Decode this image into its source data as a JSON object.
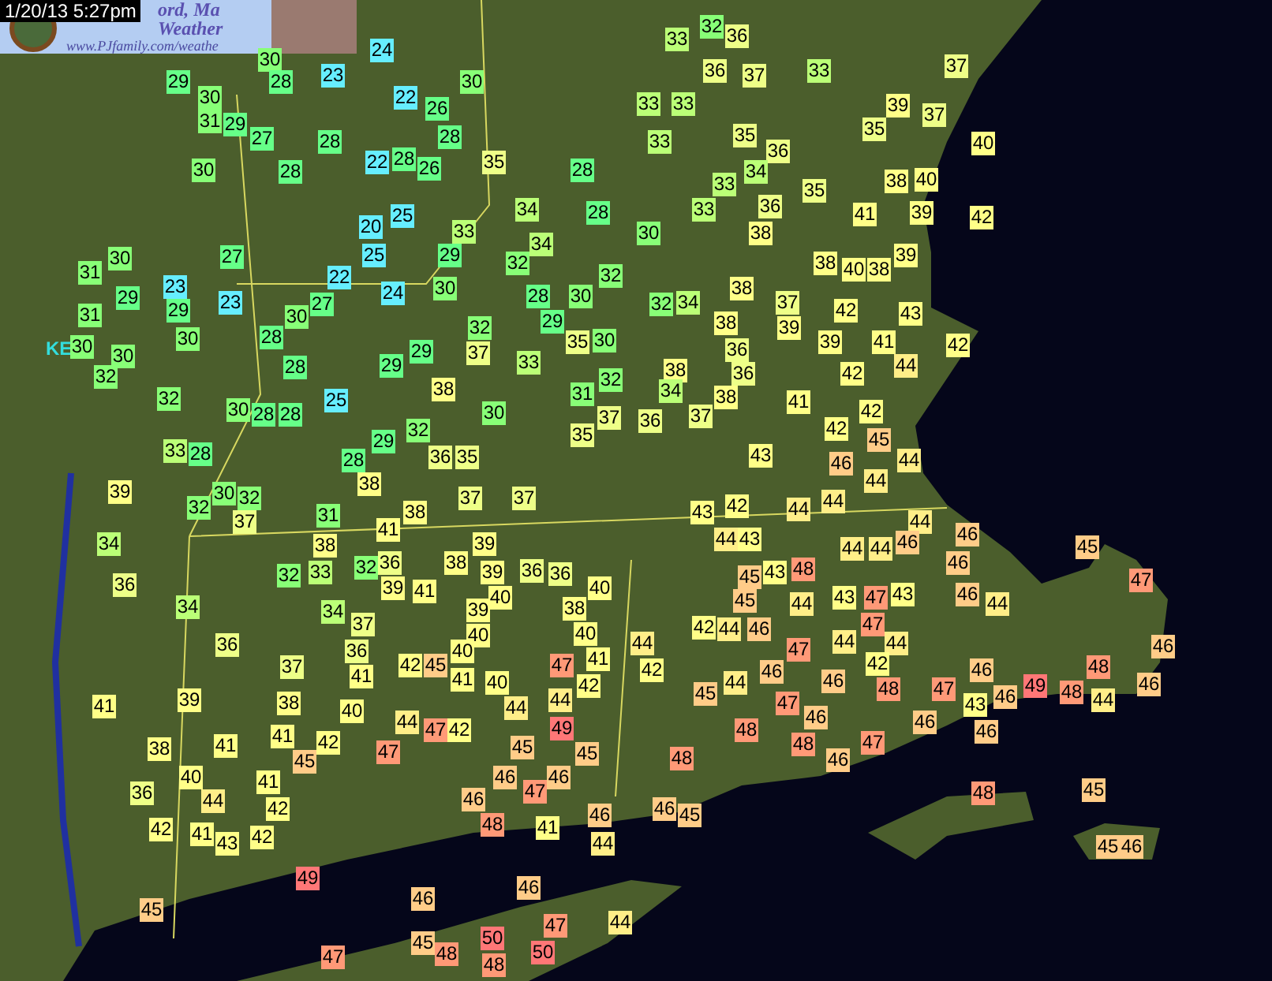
{
  "timestamp": "1/20/13 5:27pm",
  "banner": {
    "title": "ord, Ma",
    "subtitle": "Weather",
    "url": "www.PJfamily.com/weathe"
  },
  "map_label": "KE",
  "stations": [
    {
      "text": "24",
      "color": "#66eeff"
    },
    {
      "text": "30",
      "color": "#88ff77"
    },
    {
      "text": "29",
      "color": "#66ff88"
    },
    {
      "text": "28",
      "color": "#66ff88"
    },
    {
      "text": "23",
      "color": "#66eeff"
    },
    {
      "text": "30",
      "color": "#88ff77"
    },
    {
      "text": "30",
      "color": "#88ff77"
    },
    {
      "text": "22",
      "color": "#66eeff"
    },
    {
      "text": "26",
      "color": "#66ff88"
    },
    {
      "text": "31",
      "color": "#88ff77"
    },
    {
      "text": "29",
      "color": "#66ff88"
    },
    {
      "text": "27",
      "color": "#66ff88"
    },
    {
      "text": "28",
      "color": "#66ff88"
    },
    {
      "text": "28",
      "color": "#66ff88"
    },
    {
      "text": "30",
      "color": "#88ff77"
    },
    {
      "text": "28",
      "color": "#66ff88"
    },
    {
      "text": "22",
      "color": "#66eeff"
    },
    {
      "text": "28",
      "color": "#66ff88"
    },
    {
      "text": "26",
      "color": "#66ff88"
    },
    {
      "text": "35",
      "color": "#eeff88"
    },
    {
      "text": "28",
      "color": "#66ff88"
    },
    {
      "text": "25",
      "color": "#66eeff"
    },
    {
      "text": "20",
      "color": "#66eeff"
    },
    {
      "text": "34",
      "color": "#bbff77"
    },
    {
      "text": "28",
      "color": "#66ff88"
    },
    {
      "text": "27",
      "color": "#66ff88"
    },
    {
      "text": "25",
      "color": "#66eeff"
    },
    {
      "text": "22",
      "color": "#66eeff"
    },
    {
      "text": "24",
      "color": "#66eeff"
    },
    {
      "text": "30",
      "color": "#88ff77"
    },
    {
      "text": "28",
      "color": "#66ff88"
    },
    {
      "text": "29",
      "color": "#66ff88"
    },
    {
      "text": "30",
      "color": "#88ff77"
    },
    {
      "text": "23",
      "color": "#66eeff"
    },
    {
      "text": "31",
      "color": "#88ff77"
    },
    {
      "text": "30",
      "color": "#88ff77"
    },
    {
      "text": "23",
      "color": "#66eeff"
    },
    {
      "text": "27",
      "color": "#66ff88"
    },
    {
      "text": "30",
      "color": "#88ff77"
    },
    {
      "text": "28",
      "color": "#66ff88"
    },
    {
      "text": "29",
      "color": "#66ff88"
    },
    {
      "text": "29",
      "color": "#66ff88"
    },
    {
      "text": "31",
      "color": "#88ff77"
    },
    {
      "text": "30",
      "color": "#88ff77"
    },
    {
      "text": "30",
      "color": "#88ff77"
    },
    {
      "text": "30",
      "color": "#88ff77"
    },
    {
      "text": "32",
      "color": "#88ff77"
    },
    {
      "text": "32",
      "color": "#88ff77"
    },
    {
      "text": "35",
      "color": "#eeff88"
    },
    {
      "text": "30",
      "color": "#88ff77"
    },
    {
      "text": "29",
      "color": "#66ff88"
    },
    {
      "text": "37",
      "color": "#eeff88"
    },
    {
      "text": "29",
      "color": "#66ff88"
    },
    {
      "text": "33",
      "color": "#bbff77"
    },
    {
      "text": "38",
      "color": "#ffff88"
    },
    {
      "text": "28",
      "color": "#66ff88"
    },
    {
      "text": "32",
      "color": "#88ff77"
    },
    {
      "text": "25",
      "color": "#66eeff"
    },
    {
      "text": "30",
      "color": "#88ff77"
    },
    {
      "text": "28",
      "color": "#66ff88"
    },
    {
      "text": "28",
      "color": "#66ff88"
    },
    {
      "text": "30",
      "color": "#88ff77"
    },
    {
      "text": "32",
      "color": "#88ff77"
    },
    {
      "text": "31",
      "color": "#88ff77"
    },
    {
      "text": "37",
      "color": "#eeff88"
    },
    {
      "text": "35",
      "color": "#eeff88"
    },
    {
      "text": "29",
      "color": "#66ff88"
    },
    {
      "text": "32",
      "color": "#88ff77"
    },
    {
      "text": "33",
      "color": "#bbff77"
    },
    {
      "text": "28",
      "color": "#66ff88"
    },
    {
      "text": "28",
      "color": "#66ff88"
    },
    {
      "text": "36",
      "color": "#eeff88"
    },
    {
      "text": "35",
      "color": "#eeff88"
    },
    {
      "text": "29",
      "color": "#66ff88"
    },
    {
      "text": "34",
      "color": "#bbff77"
    },
    {
      "text": "32",
      "color": "#88ff77"
    },
    {
      "text": "33",
      "color": "#bbff77"
    },
    {
      "text": "32",
      "color": "#88ff77"
    },
    {
      "text": "32",
      "color": "#88ff77"
    },
    {
      "text": "33",
      "color": "#bbff77"
    },
    {
      "text": "36",
      "color": "#eeff88"
    },
    {
      "text": "36",
      "color": "#eeff88"
    },
    {
      "text": "37",
      "color": "#eeff88"
    },
    {
      "text": "33",
      "color": "#bbff77"
    },
    {
      "text": "37",
      "color": "#eeff88"
    },
    {
      "text": "33",
      "color": "#bbff77"
    },
    {
      "text": "33",
      "color": "#bbff77"
    },
    {
      "text": "39",
      "color": "#ffff88"
    },
    {
      "text": "37",
      "color": "#eeff88"
    },
    {
      "text": "35",
      "color": "#eeff88"
    },
    {
      "text": "33",
      "color": "#bbff77"
    },
    {
      "text": "35",
      "color": "#eeff88"
    },
    {
      "text": "36",
      "color": "#eeff88"
    },
    {
      "text": "40",
      "color": "#ffff88"
    },
    {
      "text": "34",
      "color": "#bbff77"
    },
    {
      "text": "33",
      "color": "#bbff77"
    },
    {
      "text": "35",
      "color": "#eeff88"
    },
    {
      "text": "38",
      "color": "#ffff88"
    },
    {
      "text": "40",
      "color": "#ffff88"
    },
    {
      "text": "33",
      "color": "#bbff77"
    },
    {
      "text": "36",
      "color": "#eeff88"
    },
    {
      "text": "41",
      "color": "#ffff88"
    },
    {
      "text": "39",
      "color": "#ffff88"
    },
    {
      "text": "42",
      "color": "#ffff88"
    },
    {
      "text": "30",
      "color": "#88ff77"
    },
    {
      "text": "38",
      "color": "#ffff88"
    },
    {
      "text": "38",
      "color": "#ffff88"
    },
    {
      "text": "39",
      "color": "#ffff88"
    },
    {
      "text": "40",
      "color": "#ffff88"
    },
    {
      "text": "38",
      "color": "#ffff88"
    },
    {
      "text": "38",
      "color": "#ffff88"
    },
    {
      "text": "32",
      "color": "#88ff77"
    },
    {
      "text": "34",
      "color": "#bbff77"
    },
    {
      "text": "37",
      "color": "#eeff88"
    },
    {
      "text": "38",
      "color": "#ffff88"
    },
    {
      "text": "42",
      "color": "#ffff88"
    },
    {
      "text": "43",
      "color": "#ffff88"
    },
    {
      "text": "39",
      "color": "#ffff88"
    },
    {
      "text": "36",
      "color": "#eeff88"
    },
    {
      "text": "39",
      "color": "#ffff88"
    },
    {
      "text": "41",
      "color": "#ffff88"
    },
    {
      "text": "42",
      "color": "#ffff88"
    },
    {
      "text": "38",
      "color": "#ffff88"
    },
    {
      "text": "36",
      "color": "#eeff88"
    },
    {
      "text": "42",
      "color": "#ffff88"
    },
    {
      "text": "44",
      "color": "#ffee88"
    },
    {
      "text": "34",
      "color": "#bbff77"
    },
    {
      "text": "38",
      "color": "#ffff88"
    },
    {
      "text": "41",
      "color": "#ffff88"
    },
    {
      "text": "42",
      "color": "#ffff88"
    },
    {
      "text": "36",
      "color": "#eeff88"
    },
    {
      "text": "37",
      "color": "#eeff88"
    },
    {
      "text": "42",
      "color": "#ffff88"
    },
    {
      "text": "45",
      "color": "#ffcc88"
    },
    {
      "text": "43",
      "color": "#ffff88"
    },
    {
      "text": "46",
      "color": "#ffcc88"
    },
    {
      "text": "44",
      "color": "#ffee88"
    },
    {
      "text": "39",
      "color": "#ffff88"
    },
    {
      "text": "32",
      "color": "#88ff77"
    },
    {
      "text": "30",
      "color": "#88ff77"
    },
    {
      "text": "32",
      "color": "#88ff77"
    },
    {
      "text": "37",
      "color": "#eeff88"
    },
    {
      "text": "31",
      "color": "#88ff77"
    },
    {
      "text": "38",
      "color": "#ffff88"
    },
    {
      "text": "38",
      "color": "#ffff88"
    },
    {
      "text": "37",
      "color": "#eeff88"
    },
    {
      "text": "37",
      "color": "#eeff88"
    },
    {
      "text": "41",
      "color": "#ffff88"
    },
    {
      "text": "34",
      "color": "#bbff77"
    },
    {
      "text": "38",
      "color": "#ffff88"
    },
    {
      "text": "39",
      "color": "#ffff88"
    },
    {
      "text": "36",
      "color": "#eeff88"
    },
    {
      "text": "32",
      "color": "#88ff77"
    },
    {
      "text": "33",
      "color": "#bbff77"
    },
    {
      "text": "32",
      "color": "#88ff77"
    },
    {
      "text": "36",
      "color": "#eeff88"
    },
    {
      "text": "38",
      "color": "#ffff88"
    },
    {
      "text": "39",
      "color": "#ffff88"
    },
    {
      "text": "36",
      "color": "#eeff88"
    },
    {
      "text": "36",
      "color": "#eeff88"
    },
    {
      "text": "39",
      "color": "#ffff88"
    },
    {
      "text": "41",
      "color": "#ffff88"
    },
    {
      "text": "40",
      "color": "#ffff88"
    },
    {
      "text": "40",
      "color": "#ffff88"
    },
    {
      "text": "34",
      "color": "#bbff77"
    },
    {
      "text": "34",
      "color": "#bbff77"
    },
    {
      "text": "38",
      "color": "#ffff88"
    },
    {
      "text": "37",
      "color": "#eeff88"
    },
    {
      "text": "36",
      "color": "#eeff88"
    },
    {
      "text": "39",
      "color": "#ffff88"
    },
    {
      "text": "40",
      "color": "#ffff88"
    },
    {
      "text": "40",
      "color": "#ffff88"
    },
    {
      "text": "36",
      "color": "#eeff88"
    },
    {
      "text": "37",
      "color": "#eeff88"
    },
    {
      "text": "42",
      "color": "#ffff88"
    },
    {
      "text": "45",
      "color": "#ffcc88"
    },
    {
      "text": "40",
      "color": "#ffff88"
    },
    {
      "text": "47",
      "color": "#ff9977"
    },
    {
      "text": "41",
      "color": "#ffff88"
    },
    {
      "text": "41",
      "color": "#ffff88"
    },
    {
      "text": "41",
      "color": "#ffff88"
    },
    {
      "text": "40",
      "color": "#ffff88"
    },
    {
      "text": "42",
      "color": "#ffff88"
    },
    {
      "text": "41",
      "color": "#ffff88"
    },
    {
      "text": "39",
      "color": "#ffff88"
    },
    {
      "text": "38",
      "color": "#ffff88"
    },
    {
      "text": "40",
      "color": "#ffff88"
    },
    {
      "text": "44",
      "color": "#ffee88"
    },
    {
      "text": "44",
      "color": "#ffee88"
    },
    {
      "text": "38",
      "color": "#ffff88"
    },
    {
      "text": "41",
      "color": "#ffff88"
    },
    {
      "text": "41",
      "color": "#ffff88"
    },
    {
      "text": "45",
      "color": "#ffcc88"
    },
    {
      "text": "42",
      "color": "#ffff88"
    },
    {
      "text": "44",
      "color": "#ffee88"
    },
    {
      "text": "47",
      "color": "#ff9977"
    },
    {
      "text": "47",
      "color": "#ff9977"
    },
    {
      "text": "42",
      "color": "#ffff88"
    },
    {
      "text": "45",
      "color": "#ffcc88"
    },
    {
      "text": "49",
      "color": "#ff7777"
    },
    {
      "text": "45",
      "color": "#ffcc88"
    },
    {
      "text": "36",
      "color": "#eeff88"
    },
    {
      "text": "40",
      "color": "#ffff88"
    },
    {
      "text": "44",
      "color": "#ffee88"
    },
    {
      "text": "41",
      "color": "#ffff88"
    },
    {
      "text": "46",
      "color": "#ffcc88"
    },
    {
      "text": "46",
      "color": "#ffcc88"
    },
    {
      "text": "47",
      "color": "#ff9977"
    },
    {
      "text": "46",
      "color": "#ffcc88"
    },
    {
      "text": "42",
      "color": "#ffff88"
    },
    {
      "text": "41",
      "color": "#ffff88"
    },
    {
      "text": "43",
      "color": "#ffff88"
    },
    {
      "text": "42",
      "color": "#ffff88"
    },
    {
      "text": "42",
      "color": "#ffff88"
    },
    {
      "text": "48",
      "color": "#ff9977"
    },
    {
      "text": "41",
      "color": "#ffff88"
    },
    {
      "text": "46",
      "color": "#ffcc88"
    },
    {
      "text": "44",
      "color": "#ffee88"
    },
    {
      "text": "49",
      "color": "#ff7777"
    },
    {
      "text": "46",
      "color": "#ffcc88"
    },
    {
      "text": "46",
      "color": "#ffcc88"
    },
    {
      "text": "45",
      "color": "#ffcc88"
    },
    {
      "text": "47",
      "color": "#ff9977"
    },
    {
      "text": "45",
      "color": "#ffcc88"
    },
    {
      "text": "48",
      "color": "#ff9977"
    },
    {
      "text": "50",
      "color": "#ff7777"
    },
    {
      "text": "48",
      "color": "#ff9977"
    },
    {
      "text": "47",
      "color": "#ff9977"
    },
    {
      "text": "50",
      "color": "#ff7777"
    },
    {
      "text": "44",
      "color": "#ffee88"
    },
    {
      "text": "44",
      "color": "#ffee88"
    },
    {
      "text": "43",
      "color": "#ffff88"
    },
    {
      "text": "42",
      "color": "#ffff88"
    },
    {
      "text": "44",
      "color": "#ffee88"
    },
    {
      "text": "44",
      "color": "#ffee88"
    },
    {
      "text": "44",
      "color": "#ffee88"
    },
    {
      "text": "44",
      "color": "#ffee88"
    },
    {
      "text": "43",
      "color": "#ffff88"
    },
    {
      "text": "44",
      "color": "#ffee88"
    },
    {
      "text": "44",
      "color": "#ffee88"
    },
    {
      "text": "46",
      "color": "#ffcc88"
    },
    {
      "text": "46",
      "color": "#ffcc88"
    },
    {
      "text": "45",
      "color": "#ffcc88"
    },
    {
      "text": "45",
      "color": "#ffcc88"
    },
    {
      "text": "43",
      "color": "#ffff88"
    },
    {
      "text": "48",
      "color": "#ff9977"
    },
    {
      "text": "46",
      "color": "#ffcc88"
    },
    {
      "text": "47",
      "color": "#ff9977"
    },
    {
      "text": "45",
      "color": "#ffcc88"
    },
    {
      "text": "44",
      "color": "#ffee88"
    },
    {
      "text": "43",
      "color": "#ffff88"
    },
    {
      "text": "47",
      "color": "#ff9977"
    },
    {
      "text": "43",
      "color": "#ffff88"
    },
    {
      "text": "46",
      "color": "#ffcc88"
    },
    {
      "text": "44",
      "color": "#ffee88"
    },
    {
      "text": "47",
      "color": "#ff9977"
    },
    {
      "text": "44",
      "color": "#ffee88"
    },
    {
      "text": "42",
      "color": "#ffff88"
    },
    {
      "text": "44",
      "color": "#ffee88"
    },
    {
      "text": "46",
      "color": "#ffcc88"
    },
    {
      "text": "47",
      "color": "#ff9977"
    },
    {
      "text": "44",
      "color": "#ffee88"
    },
    {
      "text": "44",
      "color": "#ffee88"
    },
    {
      "text": "46",
      "color": "#ffcc88"
    },
    {
      "text": "42",
      "color": "#ffff88"
    },
    {
      "text": "45",
      "color": "#ffcc88"
    },
    {
      "text": "44",
      "color": "#ffee88"
    },
    {
      "text": "46",
      "color": "#ffcc88"
    },
    {
      "text": "47",
      "color": "#ff9977"
    },
    {
      "text": "46",
      "color": "#ffcc88"
    },
    {
      "text": "42",
      "color": "#ffff88"
    },
    {
      "text": "48",
      "color": "#ff9977"
    },
    {
      "text": "47",
      "color": "#ff9977"
    },
    {
      "text": "46",
      "color": "#ffcc88"
    },
    {
      "text": "43",
      "color": "#ffff88"
    },
    {
      "text": "46",
      "color": "#ffcc88"
    },
    {
      "text": "49",
      "color": "#ff7777"
    },
    {
      "text": "48",
      "color": "#ff9977"
    },
    {
      "text": "48",
      "color": "#ff9977"
    },
    {
      "text": "44",
      "color": "#ffee88"
    },
    {
      "text": "46",
      "color": "#ffcc88"
    },
    {
      "text": "46",
      "color": "#ffcc88"
    },
    {
      "text": "48",
      "color": "#ff9977"
    },
    {
      "text": "46",
      "color": "#ffcc88"
    },
    {
      "text": "46",
      "color": "#ffcc88"
    },
    {
      "text": "48",
      "color": "#ff9977"
    },
    {
      "text": "47",
      "color": "#ff9977"
    },
    {
      "text": "48",
      "color": "#ff9977"
    },
    {
      "text": "46",
      "color": "#ffcc88"
    },
    {
      "text": "48",
      "color": "#ff9977"
    },
    {
      "text": "45",
      "color": "#ffcc88"
    },
    {
      "text": "45",
      "color": "#ffcc88"
    },
    {
      "text": "46",
      "color": "#ffcc88"
    },
    {
      "text": "46",
      "color": "#ffcc88"
    },
    {
      "text": "45",
      "color": "#ffcc88"
    }
  ]
}
